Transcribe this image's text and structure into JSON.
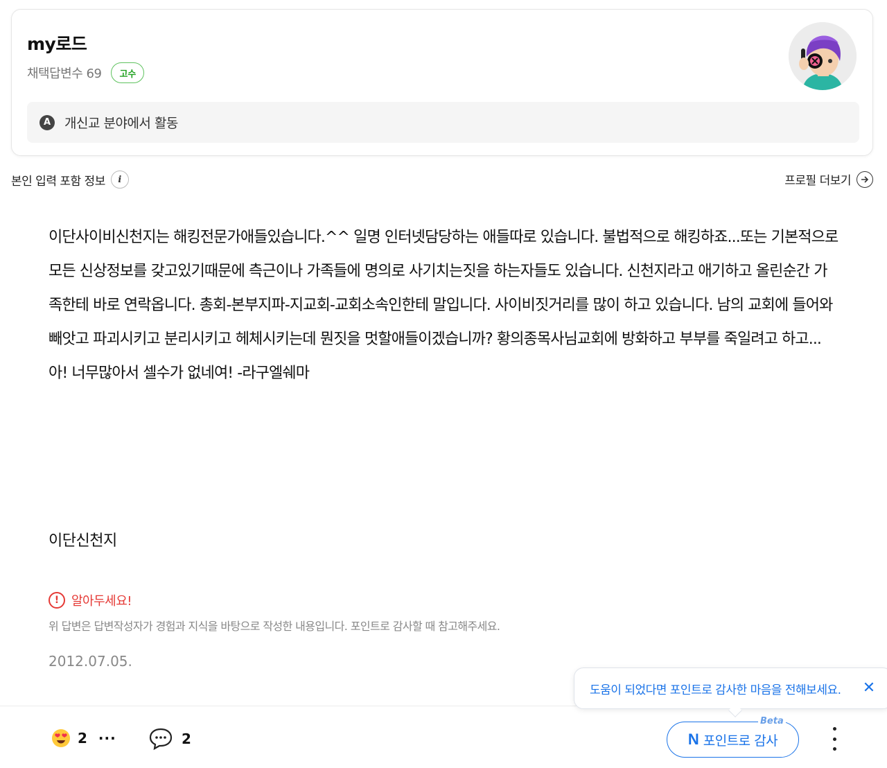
{
  "profile": {
    "name": "my로드",
    "stats_label": "채택답변수 69",
    "grade": "고수",
    "activity_icon": "A",
    "activity": "개신교 분야에서 활동"
  },
  "info": {
    "self_input_label": "본인 입력 포함 정보",
    "info_icon": "i",
    "more_profile_label": "프로필 더보기"
  },
  "answer": {
    "body": "이단사이비신천지는 해킹전문가애들있습니다.^^ 일명 인터넷담당하는 애들따로 있습니다. 불법적으로 해킹하죠...또는 기본적으로 모든 신상정보를 갖고있기때문에 측근이나 가족들에 명의로 사기치는짓을 하는자들도 있습니다. 신천지라고 애기하고 올린순간 가족한테 바로 연락옵니다. 총회-본부지파-지교회-교회소속인한테 말입니다. 사이비짓거리를 많이 하고 있습니다. 남의 교회에 들어와 빼앗고 파괴시키고 분리시키고 헤체시키는데 뭔짓을 멋할애들이겠습니까? 황의종목사님교회에 방화하고 부부를 죽일려고 하고...아! 너무많아서 셀수가 없네여! -라구엘쉐마",
    "tag": "이단신천지",
    "notice_icon": "!",
    "notice_title": "알아두세요!",
    "notice_desc": "위 답변은 답변작성자가 경험과 지식을 바탕으로 작성한 내용입니다. 포인트로 감사할 때 참고해주세요.",
    "date": "2012.07.05."
  },
  "tooltip": {
    "text": "도움이 되었다면 포인트로 감사한 마음을 전해보세요.",
    "close_icon": "✕"
  },
  "bottom_bar": {
    "reaction_count": "2",
    "reaction_more": "···",
    "comment_count": "2",
    "thanks_icon": "N",
    "thanks_label": "포인트로 감사",
    "beta_label": "Beta"
  },
  "colors": {
    "accent_blue": "#1a73e8",
    "grade_green": "#1fa11f",
    "warning_red": "#e53935"
  }
}
